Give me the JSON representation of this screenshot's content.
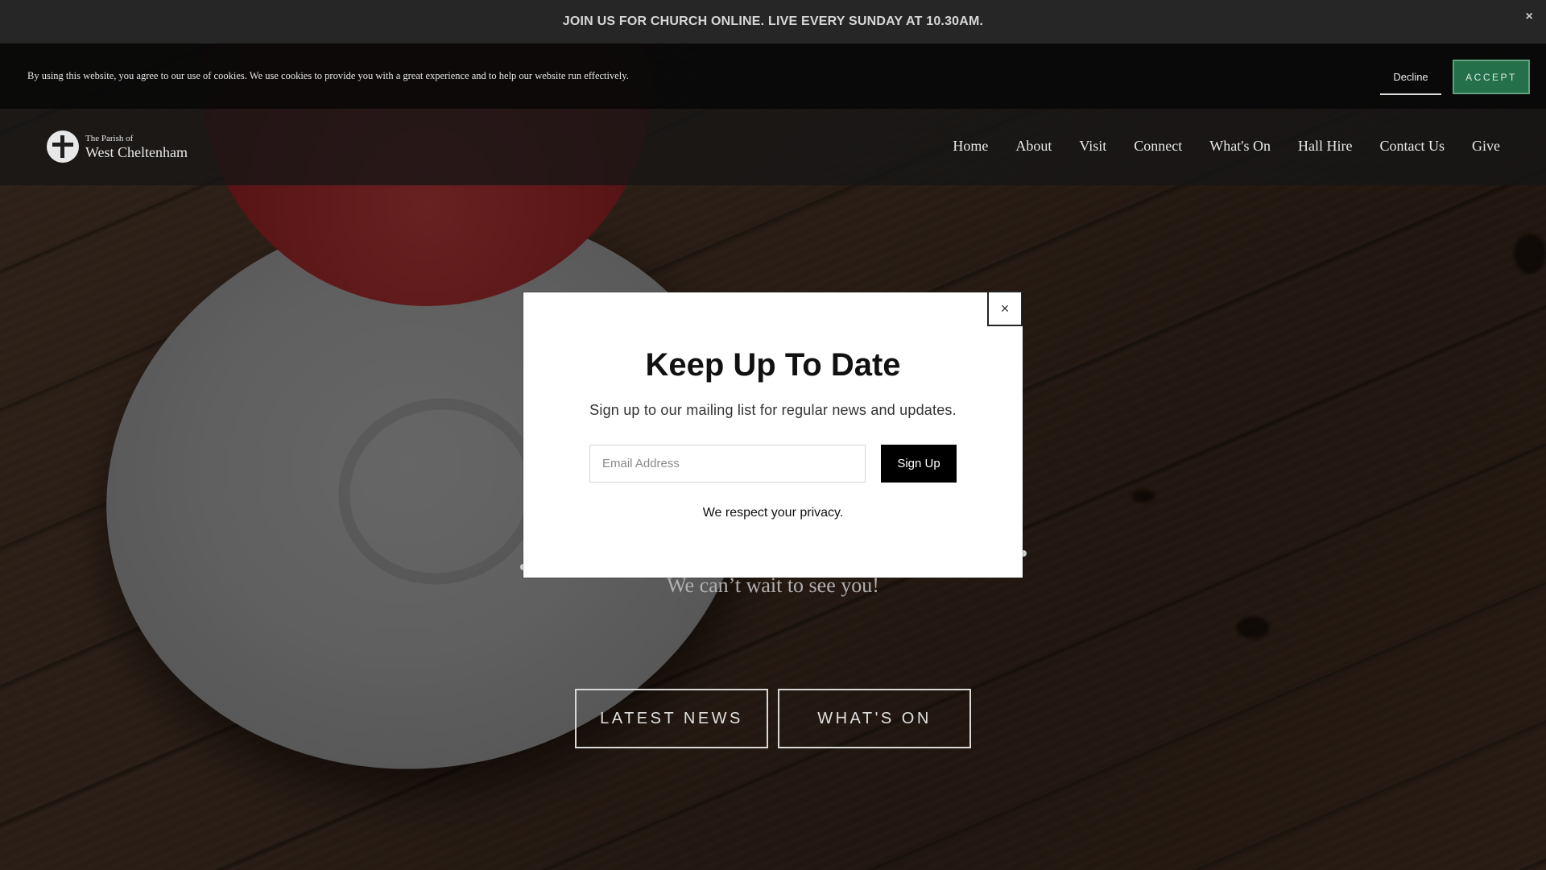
{
  "announcement": {
    "text": "JOIN US FOR CHURCH ONLINE. LIVE EVERY SUNDAY AT 10.30AM.",
    "close_label": "×"
  },
  "cookie_banner": {
    "text": "By using this website, you agree to our use of cookies. We use cookies to provide you with a great experience and to help our website run effectively.",
    "decline_label": "Decline",
    "accept_label": "ACCEPT"
  },
  "header": {
    "logo_line1": "The Parish of",
    "logo_line2": "West Cheltenham",
    "nav": [
      {
        "label": "Home"
      },
      {
        "label": "About"
      },
      {
        "label": "Visit"
      },
      {
        "label": "Connect"
      },
      {
        "label": "What's On"
      },
      {
        "label": "Hall Hire"
      },
      {
        "label": "Contact Us"
      },
      {
        "label": "Give"
      }
    ]
  },
  "hero": {
    "subtitle": "We can’t wait to see you!",
    "buttons": {
      "news_label": "LATEST NEWS",
      "whatson_label": "WHAT'S ON"
    }
  },
  "modal": {
    "close_label": "×",
    "title": "Keep Up To Date",
    "description": "Sign up to our mailing list for regular news and updates.",
    "email_placeholder": "Email Address",
    "signup_label": "Sign Up",
    "privacy_text": "We respect your privacy."
  },
  "colors": {
    "accept_button": "#24704a",
    "announcement_bg": "#262626",
    "signup_button": "#000000"
  },
  "icons": {
    "logo": "cross-in-circle-icon",
    "close": "close-icon"
  }
}
